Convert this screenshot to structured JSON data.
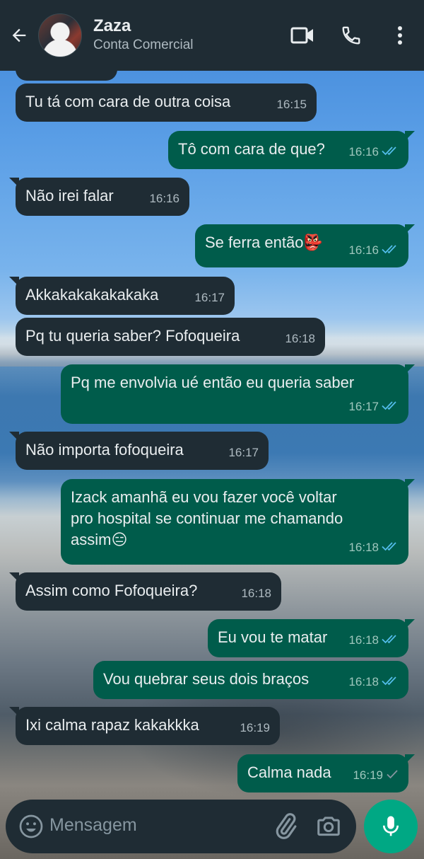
{
  "colors": {
    "header_bg": "#1f2c34",
    "incoming_bubble": "#1f2c34",
    "outgoing_bubble": "#005c4b",
    "read_tick": "#53bdeb",
    "sent_tick": "#8696a0",
    "mic_button": "#00a884"
  },
  "header": {
    "contact_name": "Zaza",
    "subtitle": "Conta Comercial",
    "icons": [
      "back-arrow-icon",
      "video-call-icon",
      "phone-icon",
      "more-options-icon"
    ]
  },
  "messages": [
    {
      "dir": "in",
      "text": "Tu tá com cara de outra coisa",
      "time": "16:15"
    },
    {
      "dir": "out",
      "text": "Tô com cara de que?",
      "time": "16:16",
      "status": "read"
    },
    {
      "dir": "in",
      "text": "Não irei falar",
      "time": "16:16"
    },
    {
      "dir": "out",
      "text": "Se ferra então👺",
      "time": "16:16",
      "status": "read"
    },
    {
      "dir": "in",
      "text": "Akkakakakakakaka",
      "time": "16:17"
    },
    {
      "dir": "in",
      "text": "Pq tu queria saber? Fofoqueira",
      "time": "16:18"
    },
    {
      "dir": "out",
      "text": "Pq me envolvia ué então eu queria saber",
      "time": "16:17",
      "status": "read"
    },
    {
      "dir": "in",
      "text": "Não importa fofoqueira",
      "time": "16:17"
    },
    {
      "dir": "out",
      "text": "Izack amanhã eu vou fazer você voltar\npro hospital se continuar me chamando\nassim😑",
      "time": "16:18",
      "status": "read"
    },
    {
      "dir": "in",
      "text": "Assim como Fofoqueira?",
      "time": "16:18"
    },
    {
      "dir": "out",
      "text": "Eu vou te matar",
      "time": "16:18",
      "status": "read"
    },
    {
      "dir": "out",
      "text": "Vou quebrar seus dois braços",
      "time": "16:18",
      "status": "read"
    },
    {
      "dir": "in",
      "text": "Ixi calma rapaz kakakkka",
      "time": "16:19"
    },
    {
      "dir": "out",
      "text": "Calma nada",
      "time": "16:19",
      "status": "sent"
    }
  ],
  "composer": {
    "placeholder": "Mensagem"
  }
}
